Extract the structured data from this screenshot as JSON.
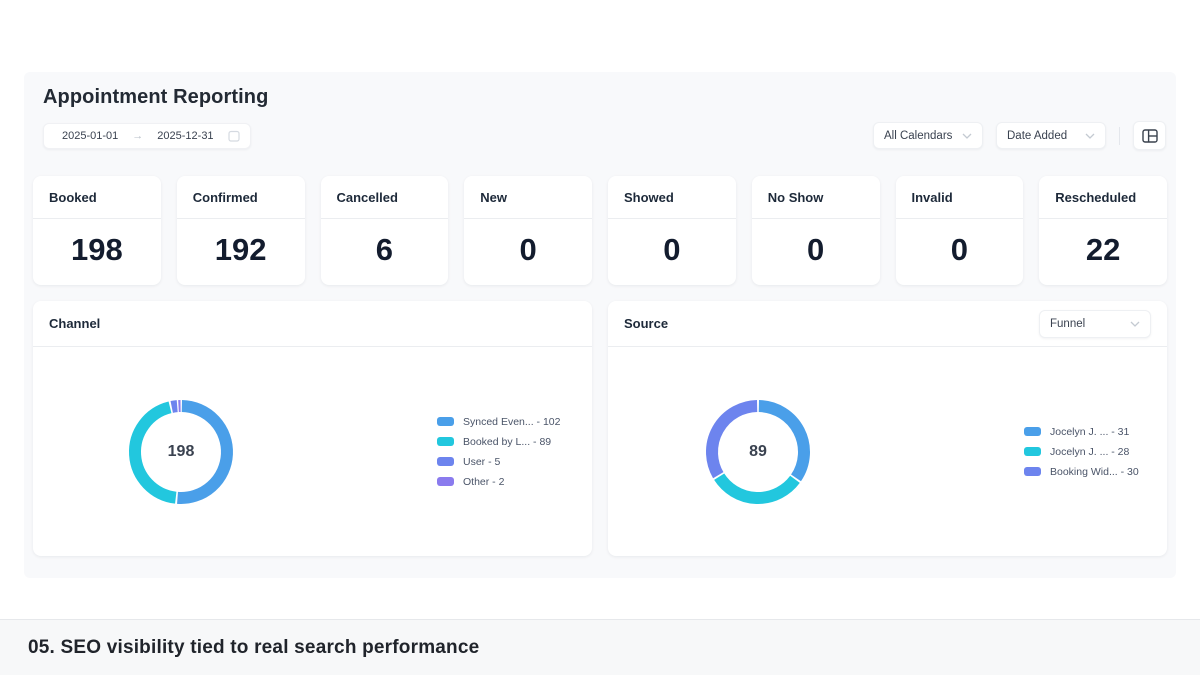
{
  "header": {
    "title": "Appointment Reporting",
    "date_start": "2025-01-01",
    "date_end": "2025-12-31",
    "calendar_filter": "All Calendars",
    "date_mode_filter": "Date Added"
  },
  "stats": [
    {
      "label": "Booked",
      "value": "198"
    },
    {
      "label": "Confirmed",
      "value": "192"
    },
    {
      "label": "Cancelled",
      "value": "6"
    },
    {
      "label": "New",
      "value": "0"
    },
    {
      "label": "Showed",
      "value": "0"
    },
    {
      "label": "No Show",
      "value": "0"
    },
    {
      "label": "Invalid",
      "value": "0"
    },
    {
      "label": "Rescheduled",
      "value": "22"
    }
  ],
  "chart_data": [
    {
      "type": "pie",
      "title": "Channel",
      "center_label": "198",
      "legend_position": "right",
      "segments": [
        {
          "label": "Synced Even... - 102",
          "value": 102,
          "color": "#4A9FE9"
        },
        {
          "label": "Booked by L... - 89",
          "value": 89,
          "color": "#22C7DE"
        },
        {
          "label": "User - 5",
          "value": 5,
          "color": "#6D84EE"
        },
        {
          "label": "Other - 2",
          "value": 2,
          "color": "#8A7BEE"
        }
      ]
    },
    {
      "type": "pie",
      "title": "Source",
      "dropdown": "Funnel",
      "center_label": "89",
      "legend_position": "right",
      "segments": [
        {
          "label": "Jocelyn J. ... - 31",
          "value": 31,
          "color": "#4A9FE9"
        },
        {
          "label": "Jocelyn J. ... - 28",
          "value": 28,
          "color": "#22C7DE"
        },
        {
          "label": "Booking Wid... - 30",
          "value": 30,
          "color": "#6D84EE"
        }
      ]
    }
  ],
  "footer": {
    "caption": "05. SEO visibility tied to real search performance"
  }
}
